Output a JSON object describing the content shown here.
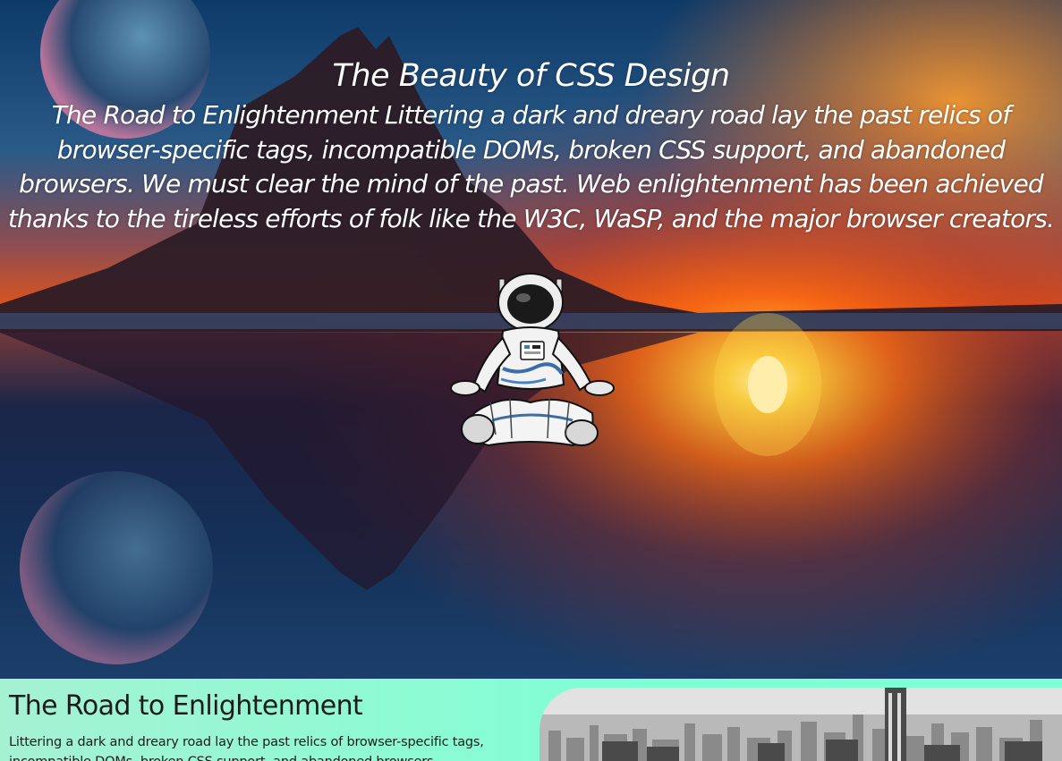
{
  "hero": {
    "title": "The Beauty of CSS Design",
    "description": "The Road to Enlightenment Littering a dark and dreary road lay the past relics of browser-specific tags, incompatible DOMs, broken CSS support, and abandoned browsers. We must clear the mind of the past. Web enlightenment has been achieved thanks to the tireless efforts of folk like the W3C, WaSP, and the major browser creators.",
    "background_icon": "sunset-lake-landscape-image",
    "figure_icon": "meditating-astronaut-image"
  },
  "section": {
    "title": "The Road to Enlightenment",
    "text": "Littering a dark and dreary road lay the past relics of browser-specific tags, incompatible DOMs, broken CSS support, and abandoned browsers.",
    "image_icon": "city-skyline-image"
  },
  "colors": {
    "section_background": "#7fffd4",
    "hero_text": "#ffffff"
  }
}
